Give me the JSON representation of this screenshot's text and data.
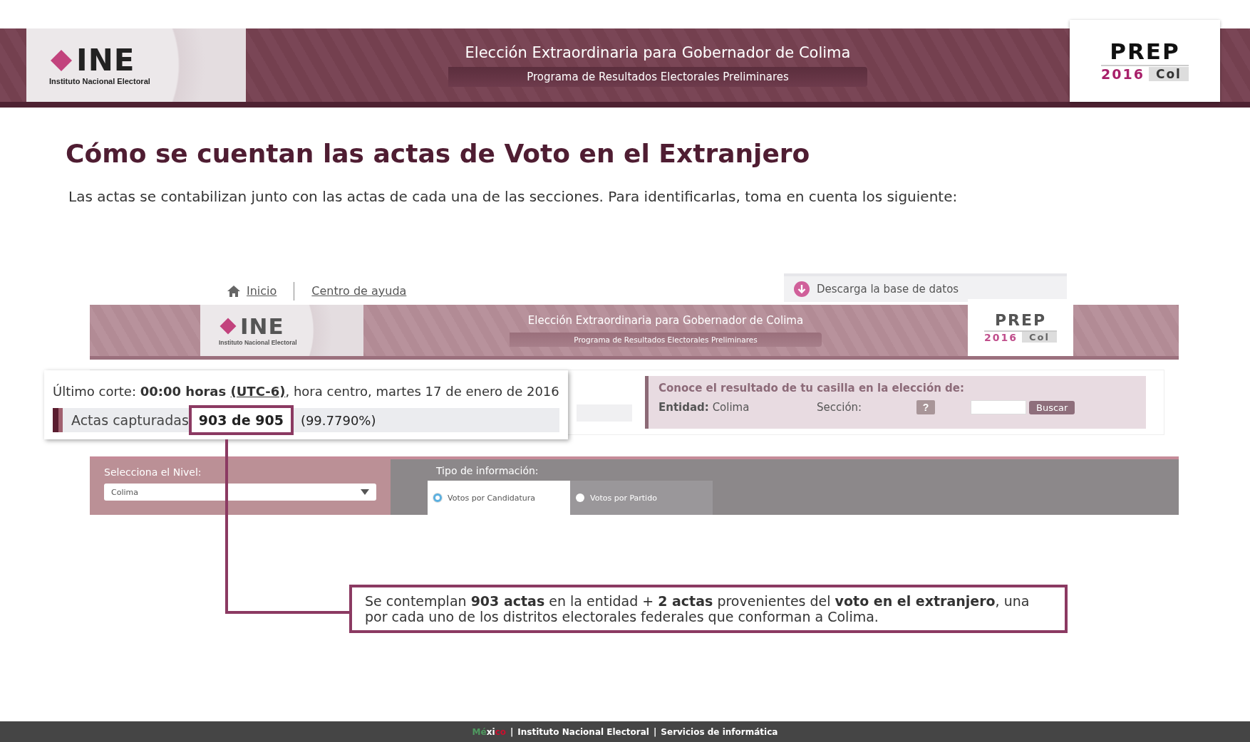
{
  "header": {
    "logo": {
      "mark": "INE",
      "caption": "Instituto Nacional Electoral"
    },
    "title": "Elección Extraordinaria para Gobernador de Colima",
    "subtitle": "Programa de Resultados Electorales Preliminares",
    "prep_logo": {
      "word": "PREP",
      "year": "2016",
      "state": "Col"
    }
  },
  "heading": "Cómo se cuentan las actas de Voto en el Extranjero",
  "intro": "Las actas se contabilizan junto con las actas de cada una de las secciones. Para identificarlas, toma en cuenta los siguiente:",
  "example": {
    "nav": [
      "Inicio",
      "Centro de ayuda"
    ],
    "download": "Descarga la base de datos",
    "header": {
      "logo": {
        "mark": "INE",
        "caption": "Instituto Nacional Electoral"
      },
      "title": "Elección Extraordinaria para Gobernador de Colima",
      "subtitle": "Programa de Resultados Electorales Preliminares",
      "prep_logo": {
        "word": "PREP",
        "year": "2016",
        "state": "Col"
      }
    },
    "cutoff": {
      "label": "Último corte:",
      "time": "00:00 horas",
      "zone": "(UTC-6)",
      "rest": ", hora centro, martes 17 de enero de 2016"
    },
    "captured": {
      "label": "Actas capturadas",
      "count": "903 de 905",
      "percent": "(99.7790%)"
    },
    "search": {
      "title": "Conoce el resultado de tu casilla en la elección de:",
      "entity_label": "Entidad:",
      "entity": "Colima",
      "section_label": "Sección:",
      "help": "?",
      "button": "Buscar"
    },
    "level": {
      "label": "Selecciona el Nivel:",
      "value": "Colima"
    },
    "info": {
      "label": "Tipo de información:",
      "options": [
        {
          "label": "Votos por Candidatura",
          "selected": true
        },
        {
          "label": "Votos por Partido",
          "selected": false
        }
      ]
    }
  },
  "callout": "Se contemplan **903 actas** en la entidad + **2 actas** provenientes del **voto en el extranjero**, una por cada uno de los distritos electorales federales que conforman a Colima.",
  "footer": {
    "country": [
      {
        "text": "Mé",
        "color": "#4f9a60"
      },
      {
        "text": "xi",
        "color": "#ffffff"
      },
      {
        "text": "co",
        "color": "#c8102e"
      }
    ],
    "separator": "|",
    "links": [
      "Instituto Nacional Electoral",
      "Servicios de informática"
    ]
  }
}
